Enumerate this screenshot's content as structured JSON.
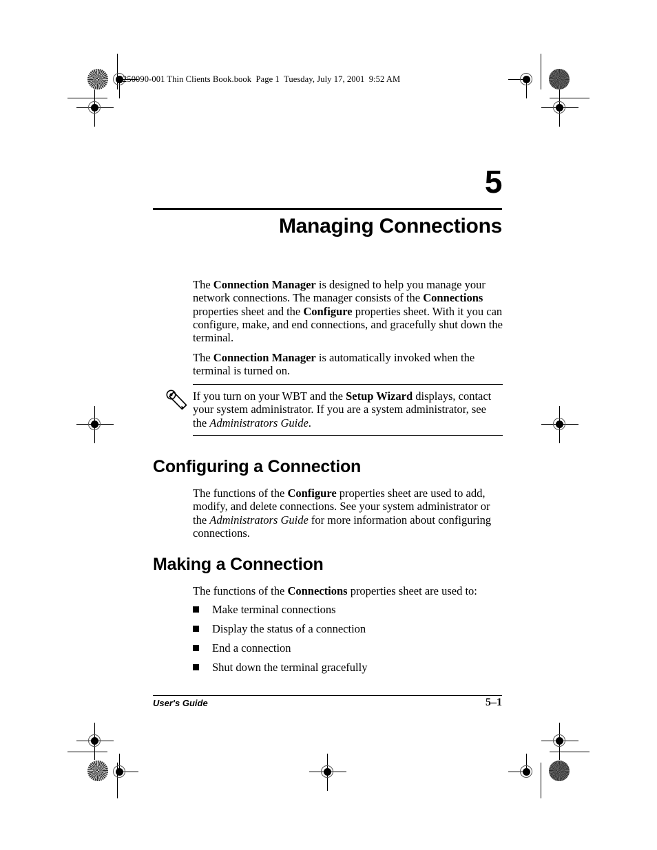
{
  "header": {
    "slug": "250090-001 Thin Clients Book.book  Page 1  Tuesday, July 17, 2001  9:52 AM"
  },
  "chapter": {
    "number": "5",
    "title": "Managing Connections"
  },
  "body": {
    "para1": {
      "seg1": "The ",
      "bold1": "Connection Manager",
      "seg2": " is designed to help you manage your network connections. The manager consists of the ",
      "bold2": "Connections",
      "seg3": " properties sheet and the ",
      "bold3": "Configure",
      "seg4": " properties sheet. With it you can configure, make, and end connections, and gracefully shut down the terminal."
    },
    "para2": {
      "seg1": "The ",
      "bold1": "Connection Manager",
      "seg2": " is automatically invoked when the terminal is turned on."
    }
  },
  "note": {
    "icon": "pencil-note-icon",
    "seg1": "If you turn on your WBT and the ",
    "bold1": "Setup Wizard",
    "seg2": " displays, contact your system administrator. If you are a system administrator, see the ",
    "italic1": "Administrators Guide",
    "seg3": "."
  },
  "sections": [
    {
      "heading": "Configuring a Connection",
      "para": {
        "seg1": "The functions of the ",
        "bold1": "Configure",
        "seg2": " properties sheet are used to add, modify, and delete connections. See your system administrator or the ",
        "italic1": "Administrators Guide",
        "seg3": " for more information about configuring connections."
      }
    },
    {
      "heading": "Making a Connection",
      "para": {
        "seg1": "The functions of the ",
        "bold1": "Connections",
        "seg2": " properties sheet are used to:"
      },
      "bullets": [
        "Make terminal connections",
        "Display the status of a connection",
        "End a connection",
        "Shut down the terminal gracefully"
      ]
    }
  ],
  "footer": {
    "left": "User's Guide",
    "page": "5–1"
  },
  "colors": {
    "ink": "#000000",
    "page": "#ffffff",
    "registration_gray": "#555555"
  }
}
